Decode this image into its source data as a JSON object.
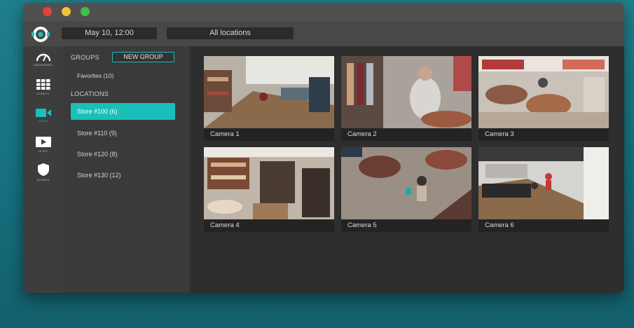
{
  "appbar": {
    "date": "May 10, 12:00",
    "location_filter": "All locations"
  },
  "sidebar": {
    "items": [
      {
        "label": "DASHBOARD",
        "icon": "dashboard-gauge-icon"
      },
      {
        "label": "EVENTS",
        "icon": "events-grid-icon"
      },
      {
        "label": "VIDEO",
        "icon": "video-camera-icon",
        "active": true
      },
      {
        "label": "CLIPS",
        "icon": "clips-play-icon"
      },
      {
        "label": "ALARMS",
        "icon": "alarms-shield-icon"
      }
    ]
  },
  "panel": {
    "groups_heading": "GROUPS",
    "new_group_label": "NEW GROUP",
    "favorites_label": "Favorites (10)",
    "locations_heading": "LOCATIONS",
    "stores": [
      "Store #100 (6)",
      "Store #110 (9)",
      "Store #120 (8)",
      "Store #130 (12)"
    ]
  },
  "cameras": [
    "Camera 1",
    "Camera 2",
    "Camera 3",
    "Camera 4",
    "Camera 5",
    "Camera 6"
  ],
  "colors": {
    "accent": "#1bbfba",
    "window": "#454545",
    "content": "#2e2e2e",
    "background": "#1f7f8c"
  }
}
